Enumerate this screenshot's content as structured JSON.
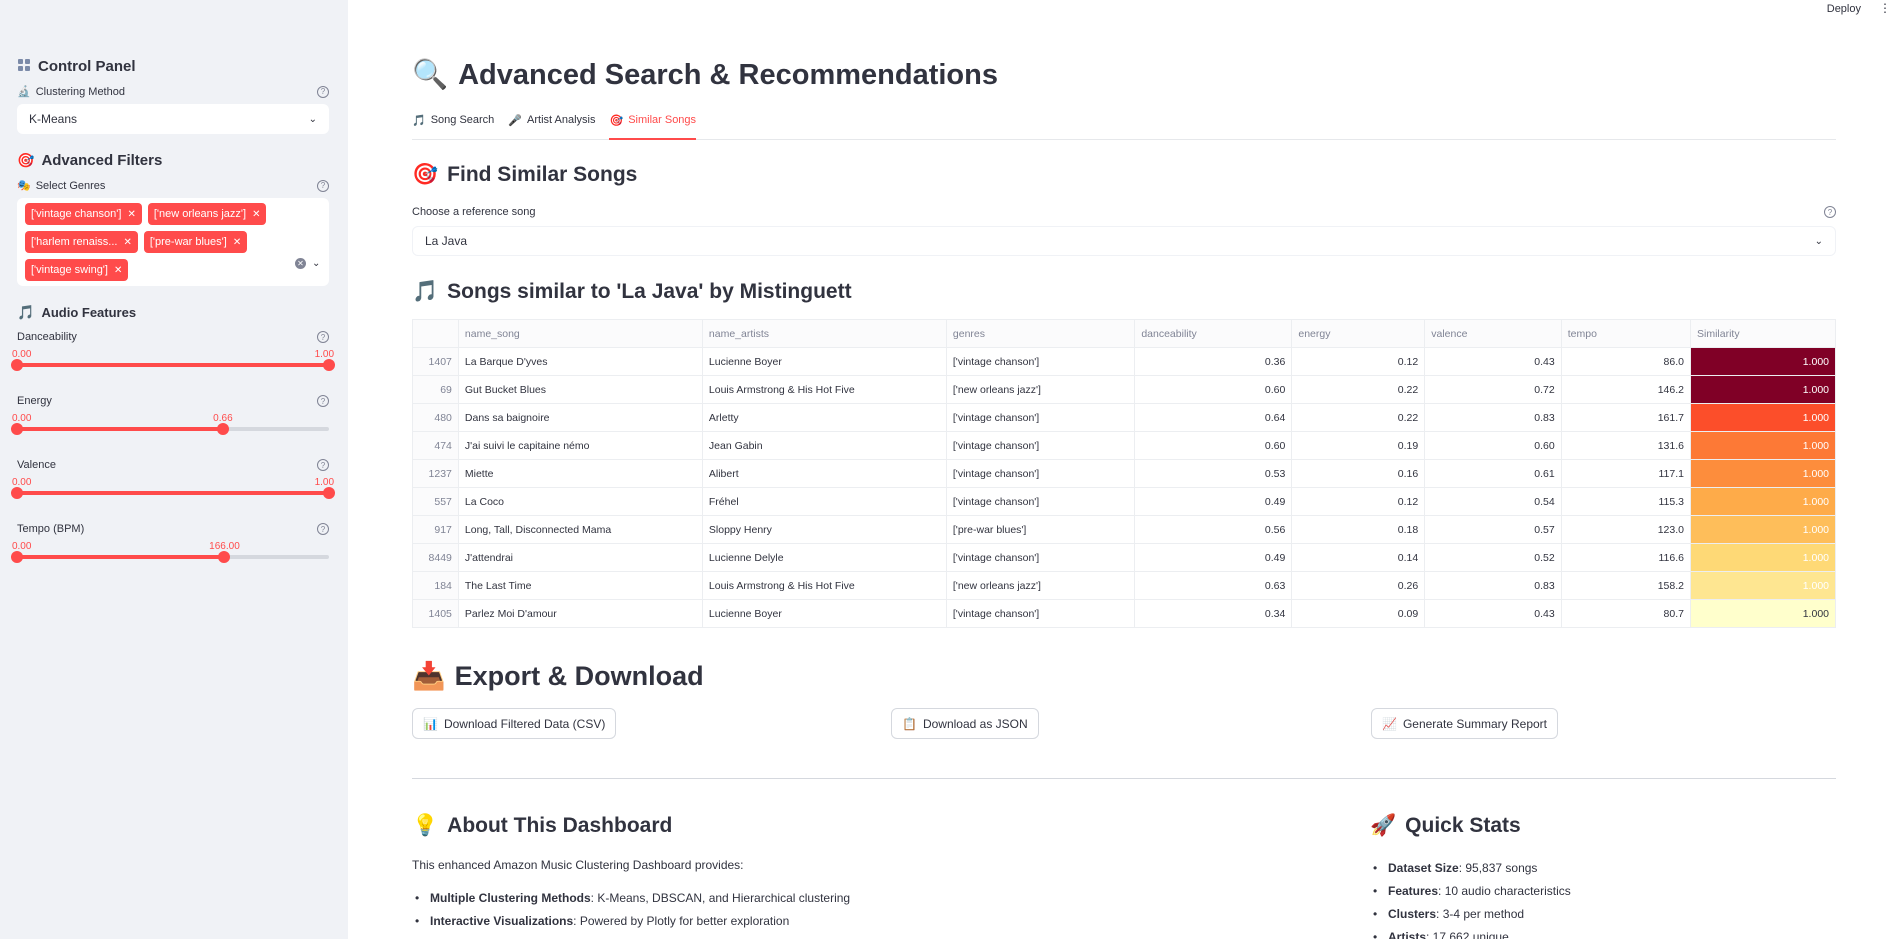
{
  "header": {
    "deploy_label": "Deploy",
    "menu_icon": "kebab-icon"
  },
  "sidebar": {
    "control_panel": {
      "title": "Control Panel",
      "icon": "control-panel-icon"
    },
    "clustering": {
      "label": "Clustering Method",
      "value": "K-Means"
    },
    "advanced_filters": {
      "title": "Advanced Filters"
    },
    "genres": {
      "label": "Select Genres",
      "tags": [
        "['vintage chanson']",
        "['new orleans jazz']",
        "['harlem renaiss...",
        "['pre-war blues']",
        "['vintage swing']"
      ]
    },
    "audio_features": {
      "title": "Audio Features"
    },
    "sliders": [
      {
        "label": "Danceability",
        "min": "0.00",
        "max": "1.00",
        "lo": 0.0,
        "hi": 1.0,
        "show_max_only_at_end": true
      },
      {
        "label": "Energy",
        "min": "0.00",
        "max": "0.66",
        "lo": 0.0,
        "hi": 0.66
      },
      {
        "label": "Valence",
        "min": "0.00",
        "max": "1.00",
        "lo": 0.0,
        "hi": 1.0
      },
      {
        "label": "Tempo (BPM)",
        "min": "0.00",
        "max": "166.00",
        "lo": 0.0,
        "hi": 0.665
      }
    ]
  },
  "main": {
    "title": "Advanced Search & Recommendations",
    "tabs": [
      "Song Search",
      "Artist Analysis",
      "Similar Songs"
    ],
    "find_title": "Find Similar Songs",
    "ref_label": "Choose a reference song",
    "ref_value": "La Java",
    "results_title": "Songs similar to 'La Java' by Mistinguett",
    "table": {
      "columns": [
        "name_song",
        "name_artists",
        "genres",
        "danceability",
        "energy",
        "valence",
        "tempo",
        "Similarity"
      ],
      "rows": [
        [
          "1407",
          "La Barque D'yves",
          "Lucienne Boyer",
          "['vintage chanson']",
          "0.36",
          "0.12",
          "0.43",
          "86.0",
          "1.000"
        ],
        [
          "69",
          "Gut Bucket Blues",
          "Louis Armstrong & His Hot Five",
          "['new orleans jazz']",
          "0.60",
          "0.22",
          "0.72",
          "146.2",
          "1.000"
        ],
        [
          "480",
          "Dans sa baignoire",
          "Arletty",
          "['vintage chanson']",
          "0.64",
          "0.22",
          "0.83",
          "161.7",
          "1.000"
        ],
        [
          "474",
          "J'ai suivi le capitaine némo",
          "Jean Gabin",
          "['vintage chanson']",
          "0.60",
          "0.19",
          "0.60",
          "131.6",
          "1.000"
        ],
        [
          "1237",
          "Miette",
          "Alibert",
          "['vintage chanson']",
          "0.53",
          "0.16",
          "0.61",
          "117.1",
          "1.000"
        ],
        [
          "557",
          "La Coco",
          "Fréhel",
          "['vintage chanson']",
          "0.49",
          "0.12",
          "0.54",
          "115.3",
          "1.000"
        ],
        [
          "917",
          "Long, Tall, Disconnected Mama",
          "Sloppy Henry",
          "['pre-war blues']",
          "0.56",
          "0.18",
          "0.57",
          "123.0",
          "1.000"
        ],
        [
          "8449",
          "J'attendrai",
          "Lucienne Delyle",
          "['vintage chanson']",
          "0.49",
          "0.14",
          "0.52",
          "116.6",
          "1.000"
        ],
        [
          "184",
          "The Last Time",
          "Louis Armstrong & His Hot Five",
          "['new orleans jazz']",
          "0.63",
          "0.26",
          "0.83",
          "158.2",
          "1.000"
        ],
        [
          "1405",
          "Parlez Moi D'amour",
          "Lucienne Boyer",
          "['vintage chanson']",
          "0.34",
          "0.09",
          "0.43",
          "80.7",
          "1.000"
        ]
      ],
      "similarity_colors": [
        "#800026",
        "#800026",
        "#fc4e2a",
        "#fd7936",
        "#fd8d3c",
        "#feab49",
        "#febe5a",
        "#fed976",
        "#fee691",
        "#ffffcc"
      ]
    },
    "export_title": "Export & Download",
    "buttons": [
      "Download Filtered Data (CSV)",
      "Download as JSON",
      "Generate Summary Report"
    ],
    "about": {
      "title": "About This Dashboard",
      "intro": "This enhanced Amazon Music Clustering Dashboard provides:",
      "items": [
        {
          "bold": "Multiple Clustering Methods",
          "text": ": K-Means, DBSCAN, and Hierarchical clustering"
        },
        {
          "bold": "Interactive Visualizations",
          "text": ": Powered by Plotly for better exploration"
        }
      ]
    },
    "stats": {
      "title": "Quick Stats",
      "items": [
        {
          "bold": "Dataset Size",
          "text": ": 95,837 songs"
        },
        {
          "bold": "Features",
          "text": ": 10 audio characteristics"
        },
        {
          "bold": "Clusters",
          "text": ": 3-4 per method"
        },
        {
          "bold": "Artists",
          "text": ": 17,662 unique"
        }
      ]
    }
  }
}
